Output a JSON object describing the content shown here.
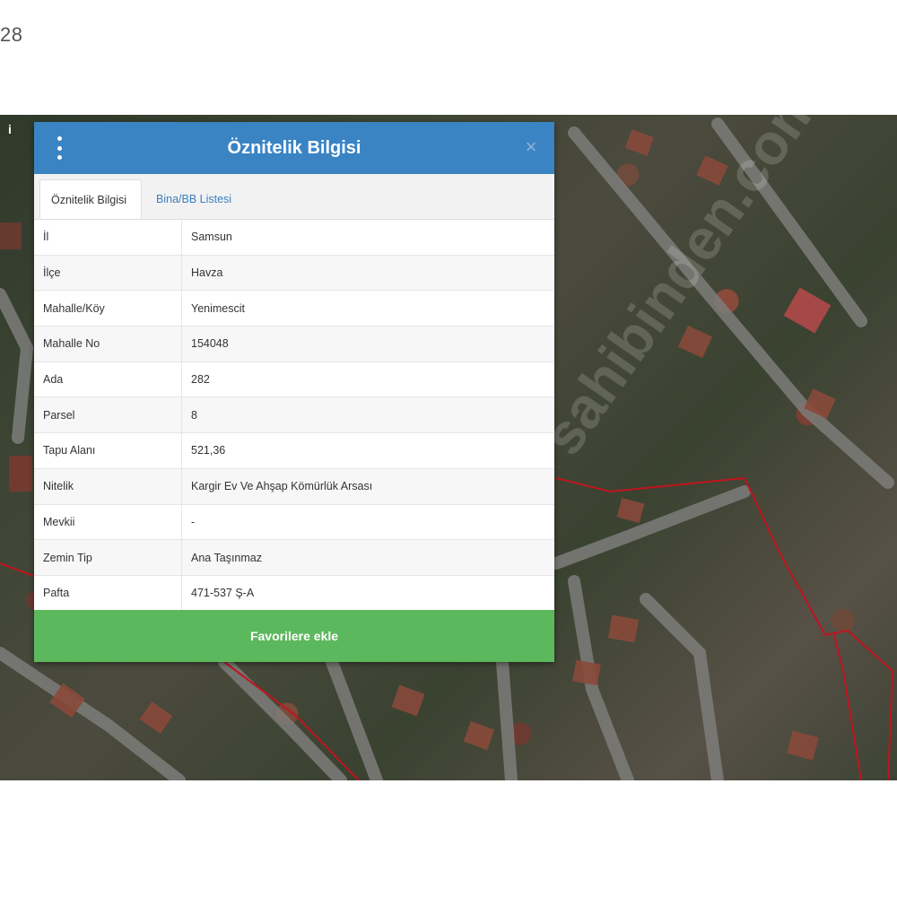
{
  "page": {
    "corner_label": "28"
  },
  "map": {
    "info_icon": "i",
    "watermark_text": "sahibinden.com"
  },
  "panel": {
    "title": "Öznitelik Bilgisi",
    "menu_icon": "kebab-icon",
    "close_label": "×",
    "tabs": [
      {
        "label": "Öznitelik Bilgisi",
        "active": true
      },
      {
        "label": "Bina/BB Listesi",
        "active": false
      }
    ],
    "rows": [
      {
        "key": "İl",
        "value": "Samsun"
      },
      {
        "key": "İlçe",
        "value": "Havza"
      },
      {
        "key": "Mahalle/Köy",
        "value": "Yenimescit"
      },
      {
        "key": "Mahalle No",
        "value": "154048"
      },
      {
        "key": "Ada",
        "value": "282"
      },
      {
        "key": "Parsel",
        "value": "8"
      },
      {
        "key": "Tapu Alanı",
        "value": "521,36"
      },
      {
        "key": "Nitelik",
        "value": "Kargir Ev Ve Ahşap Kömürlük Arsası"
      },
      {
        "key": "Mevkii",
        "value": "-"
      },
      {
        "key": "Zemin Tip",
        "value": "Ana Taşınmaz"
      },
      {
        "key": "Pafta",
        "value": "471-537 Ş-A"
      }
    ],
    "favorite_button": "Favorilere ekle"
  },
  "colors": {
    "header_blue": "#3a84c4",
    "button_green": "#5cb85c",
    "parcel_line": "#c0141e",
    "tab_link": "#3a7fbf"
  }
}
